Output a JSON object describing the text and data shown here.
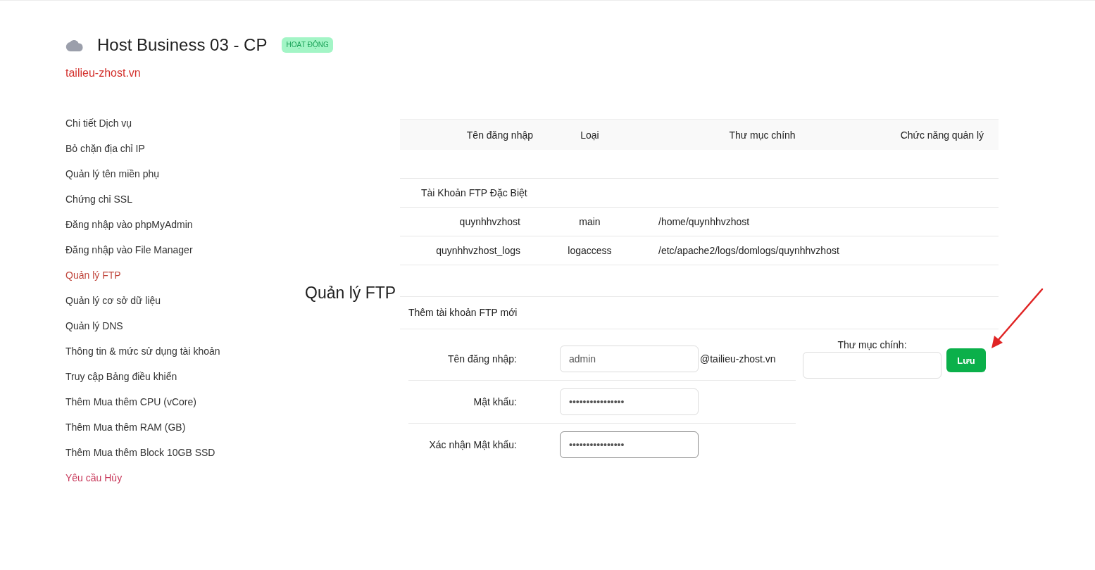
{
  "service": {
    "title": "Host Business 03 - CP",
    "status": "HOẠT ĐỘNG",
    "domain": "tailieu-zhost.vn"
  },
  "sidebar": {
    "items": [
      {
        "label": "Chi tiết Dịch vụ",
        "kind": "link",
        "selected": false
      },
      {
        "label": "Bỏ chặn địa chỉ IP",
        "kind": "link",
        "selected": false
      },
      {
        "label": "Quản lý tên miền phụ",
        "kind": "link",
        "selected": false
      },
      {
        "label": "Chứng chỉ SSL",
        "kind": "link",
        "selected": false
      },
      {
        "label": "Đăng nhập vào phpMyAdmin",
        "kind": "link",
        "selected": false
      },
      {
        "label": "Đăng nhập vào File Manager",
        "kind": "link",
        "selected": false
      },
      {
        "label": "Quản lý FTP",
        "kind": "link",
        "selected": true
      },
      {
        "label": "Quản lý cơ sở dữ liệu",
        "kind": "link",
        "selected": false
      },
      {
        "label": "Quản lý DNS",
        "kind": "link",
        "selected": false
      },
      {
        "label": "Thông tin & mức sử dụng tài khoản",
        "kind": "link",
        "selected": false
      },
      {
        "label": "Truy cập Bảng điều khiển",
        "kind": "link",
        "selected": false
      },
      {
        "label": "Thêm Mua thêm CPU (vCore)",
        "kind": "link",
        "selected": false
      },
      {
        "label": "Thêm Mua thêm RAM (GB)",
        "kind": "link",
        "selected": false
      },
      {
        "label": "Thêm Mua thêm Block 10GB SSD",
        "kind": "link",
        "selected": false
      },
      {
        "label": "Yêu cầu Hủy",
        "kind": "danger",
        "selected": false
      }
    ]
  },
  "page_heading": "Quản lý FTP",
  "ftp_table": {
    "columns": [
      "Tên đăng nhập",
      "Loại",
      "Thư mục chính",
      "Chức năng quản lý"
    ],
    "group_label": "Tài Khoản FTP Đặc Biệt",
    "rows": [
      {
        "username": "quynhhvzhost",
        "type": "main",
        "directory": "/home/quynhhvzhost"
      },
      {
        "username": "quynhhvzhost_logs",
        "type": "logaccess",
        "directory": "/etc/apache2/logs/domlogs/quynhhvzhost"
      }
    ]
  },
  "new_account_form": {
    "title": "Thêm tài khoản FTP mới",
    "fields": [
      {
        "label": "Tên đăng nhập:",
        "value": "admin",
        "suffix": "@tailieu-zhost.vn",
        "focused": false
      },
      {
        "label": "Mật khẩu:",
        "value": "••••••••••••••••",
        "focused": false
      },
      {
        "label": "Xác nhận Mật khẩu:",
        "value": "••••••••••••••••",
        "focused": true
      }
    ],
    "directory_field": {
      "label": "Thư mục chính:"
    },
    "submit_button": "Lưu"
  }
}
